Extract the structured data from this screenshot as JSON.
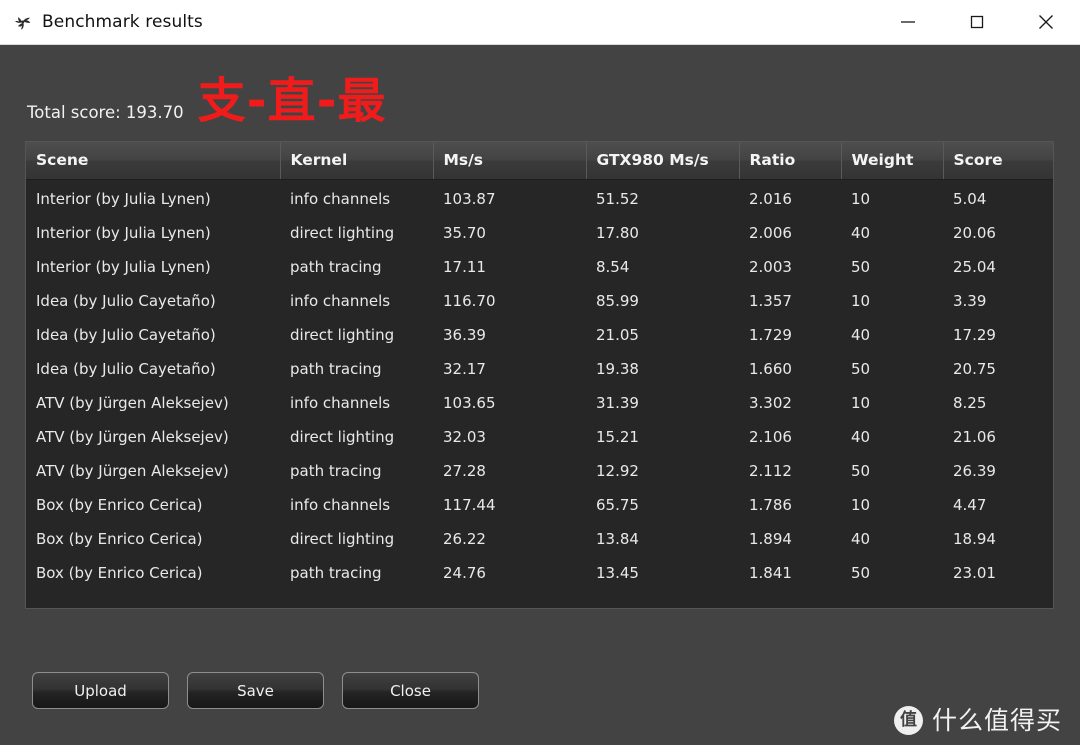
{
  "window": {
    "title": "Benchmark results",
    "icon": "pinwheel-icon",
    "controls": {
      "minimize": "minimize-icon",
      "maximize": "maximize-icon",
      "close": "close-icon"
    }
  },
  "summary": {
    "total_score_label": "Total score: 193.70",
    "total_score_value": "193.70",
    "overlay_text": "支-直-最",
    "overlay_color": "#f01c1c"
  },
  "table": {
    "columns": [
      "Scene",
      "Kernel",
      "Ms/s",
      "GTX980 Ms/s",
      "Ratio",
      "Weight",
      "Score"
    ],
    "rows": [
      {
        "scene": "Interior (by Julia Lynen)",
        "kernel": "info channels",
        "ms": "103.87",
        "gtx980": "51.52",
        "ratio": "2.016",
        "weight": "10",
        "score": "5.04"
      },
      {
        "scene": "Interior (by Julia Lynen)",
        "kernel": "direct lighting",
        "ms": "35.70",
        "gtx980": "17.80",
        "ratio": "2.006",
        "weight": "40",
        "score": "20.06"
      },
      {
        "scene": "Interior (by Julia Lynen)",
        "kernel": "path tracing",
        "ms": "17.11",
        "gtx980": "8.54",
        "ratio": "2.003",
        "weight": "50",
        "score": "25.04"
      },
      {
        "scene": "Idea (by Julio Cayetaño)",
        "kernel": "info channels",
        "ms": "116.70",
        "gtx980": "85.99",
        "ratio": "1.357",
        "weight": "10",
        "score": "3.39"
      },
      {
        "scene": "Idea (by Julio Cayetaño)",
        "kernel": "direct lighting",
        "ms": "36.39",
        "gtx980": "21.05",
        "ratio": "1.729",
        "weight": "40",
        "score": "17.29"
      },
      {
        "scene": "Idea (by Julio Cayetaño)",
        "kernel": "path tracing",
        "ms": "32.17",
        "gtx980": "19.38",
        "ratio": "1.660",
        "weight": "50",
        "score": "20.75"
      },
      {
        "scene": "ATV (by Jürgen Aleksejev)",
        "kernel": "info channels",
        "ms": "103.65",
        "gtx980": "31.39",
        "ratio": "3.302",
        "weight": "10",
        "score": "8.25"
      },
      {
        "scene": "ATV (by Jürgen Aleksejev)",
        "kernel": "direct lighting",
        "ms": "32.03",
        "gtx980": "15.21",
        "ratio": "2.106",
        "weight": "40",
        "score": "21.06"
      },
      {
        "scene": "ATV (by Jürgen Aleksejev)",
        "kernel": "path tracing",
        "ms": "27.28",
        "gtx980": "12.92",
        "ratio": "2.112",
        "weight": "50",
        "score": "26.39"
      },
      {
        "scene": "Box (by Enrico Cerica)",
        "kernel": "info channels",
        "ms": "117.44",
        "gtx980": "65.75",
        "ratio": "1.786",
        "weight": "10",
        "score": "4.47"
      },
      {
        "scene": "Box (by Enrico Cerica)",
        "kernel": "direct lighting",
        "ms": "26.22",
        "gtx980": "13.84",
        "ratio": "1.894",
        "weight": "40",
        "score": "18.94"
      },
      {
        "scene": "Box (by Enrico Cerica)",
        "kernel": "path tracing",
        "ms": "24.76",
        "gtx980": "13.45",
        "ratio": "1.841",
        "weight": "50",
        "score": "23.01"
      }
    ]
  },
  "buttons": {
    "upload": "Upload",
    "save": "Save",
    "close": "Close"
  },
  "watermark": {
    "logo_char": "值",
    "text": "什么值得买"
  }
}
